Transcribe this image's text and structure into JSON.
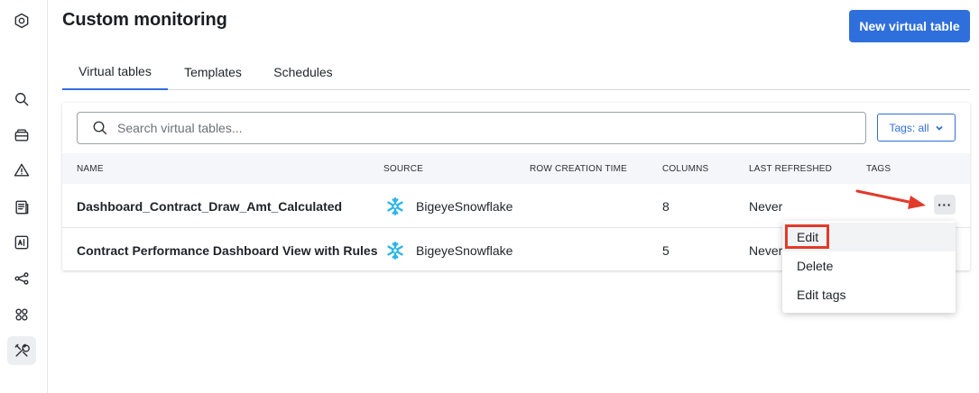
{
  "sidebar": {
    "icons": [
      "logo-icon",
      "search-icon",
      "catalog-icon",
      "issues-icon",
      "document-icon",
      "metrics-icon",
      "lineage-icon",
      "apps-icon",
      "tools-icon"
    ]
  },
  "header": {
    "title": "Custom monitoring",
    "new_button_label": "New virtual table"
  },
  "tabs": [
    {
      "label": "Virtual tables",
      "active": true
    },
    {
      "label": "Templates",
      "active": false
    },
    {
      "label": "Schedules",
      "active": false
    }
  ],
  "search": {
    "placeholder": "Search virtual tables..."
  },
  "tags_filter": {
    "label": "Tags: all"
  },
  "table": {
    "columns": [
      "NAME",
      "SOURCE",
      "ROW CREATION TIME",
      "COLUMNS",
      "LAST REFRESHED",
      "TAGS"
    ],
    "rows": [
      {
        "name": "Dashboard_Contract_Draw_Amt_Calculated",
        "source": "BigeyeSnowflake",
        "row_creation_time": "",
        "columns": "8",
        "last_refreshed": "Never",
        "tags": ""
      },
      {
        "name": "Contract Performance Dashboard View with Rules",
        "source": "BigeyeSnowflake",
        "row_creation_time": "",
        "columns": "5",
        "last_refreshed": "Never",
        "tags": ""
      }
    ]
  },
  "row_menu": {
    "more_label": "···",
    "items": [
      "Edit",
      "Delete",
      "Edit tags"
    ]
  },
  "colors": {
    "accent": "#2f6fdb",
    "annotation": "#e23a2a",
    "snowflake": "#29b5e8"
  }
}
